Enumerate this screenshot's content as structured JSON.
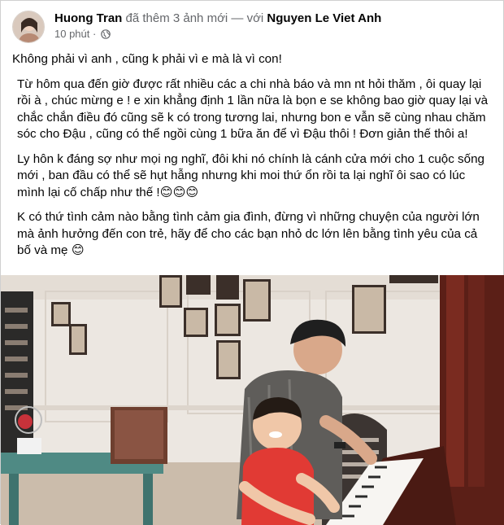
{
  "post": {
    "author": "Huong Tran",
    "action": "đã thêm 3 ảnh mới — với",
    "tagged": "Nguyen Le Viet Anh",
    "time": "10 phút",
    "privacy_icon": "globe-icon",
    "paragraphs": [
      "Không phải vì anh , cũng k phải vì e mà là vì con!",
      "Từ hôm qua đến giờ được rất nhiều các a chi nhà báo và mn nt hỏi thăm , ôi quay lại rồi à , chúc mừng e ! e xin khẳng định 1 lần nữa là bọn e se không bao giờ quay lại và chắc chắn điều đó cũng sẽ k có trong tương lai, nhưng bon e vẫn sẽ cùng nhau chăm sóc cho Đậu , cũng có thể ngồi cùng 1 bữa ăn để vì Đậu thôi ! Đơn giản thế thôi a!",
      "Ly hôn k đáng sợ như mọi ng nghĩ, đôi khi nó chính là cánh cửa mới cho 1 cuộc sống mới , ban đầu có thể sẽ hụt hẫng nhưng khi moi thứ ổn rồi ta lại nghĩ ôi sao có lúc mình lại cố chấp như thế !😊😊😊",
      "K có thứ tình cảm nào bằng tình cảm gia đình, đừng vì những chuyện của người lớn mà ảnh hưởng đến con trẻ, hãy để cho các bạn nhỏ dc lớn lên bằng tình yêu của cả bố và mẹ 😊"
    ]
  }
}
